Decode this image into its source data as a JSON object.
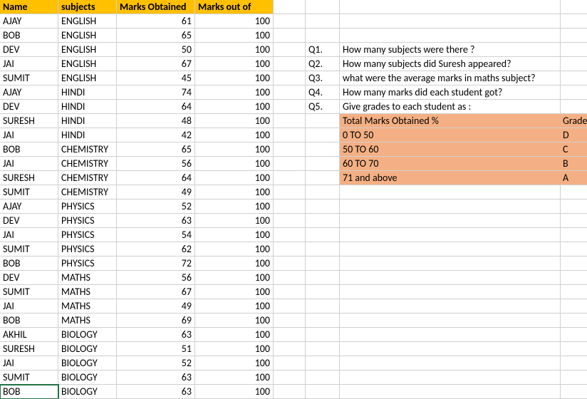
{
  "headers": {
    "name": "Name",
    "subjects": "subjects",
    "marks_obtained": "Marks Obtained",
    "marks_out_of": "Marks out of"
  },
  "rows": [
    {
      "name": "AJAY",
      "subject": "ENGLISH",
      "obtained": "61",
      "outof": "100"
    },
    {
      "name": "BOB",
      "subject": "ENGLISH",
      "obtained": "65",
      "outof": "100"
    },
    {
      "name": "DEV",
      "subject": "ENGLISH",
      "obtained": "50",
      "outof": "100"
    },
    {
      "name": "JAI",
      "subject": "ENGLISH",
      "obtained": "67",
      "outof": "100"
    },
    {
      "name": "SUMIT",
      "subject": "ENGLISH",
      "obtained": "45",
      "outof": "100"
    },
    {
      "name": "AJAY",
      "subject": "HINDI",
      "obtained": "74",
      "outof": "100"
    },
    {
      "name": "DEV",
      "subject": "HINDI",
      "obtained": "64",
      "outof": "100"
    },
    {
      "name": "SURESH",
      "subject": "HINDI",
      "obtained": "48",
      "outof": "100"
    },
    {
      "name": "JAI",
      "subject": "HINDI",
      "obtained": "42",
      "outof": "100"
    },
    {
      "name": "BOB",
      "subject": "CHEMISTRY",
      "obtained": "65",
      "outof": "100"
    },
    {
      "name": "JAI",
      "subject": "CHEMISTRY",
      "obtained": "56",
      "outof": "100"
    },
    {
      "name": "SURESH",
      "subject": "CHEMISTRY",
      "obtained": "64",
      "outof": "100"
    },
    {
      "name": "SUMIT",
      "subject": "CHEMISTRY",
      "obtained": "49",
      "outof": "100"
    },
    {
      "name": "AJAY",
      "subject": "PHYSICS",
      "obtained": "52",
      "outof": "100"
    },
    {
      "name": "DEV",
      "subject": "PHYSICS",
      "obtained": "63",
      "outof": "100"
    },
    {
      "name": "JAI",
      "subject": "PHYSICS",
      "obtained": "54",
      "outof": "100"
    },
    {
      "name": "SUMIT",
      "subject": "PHYSICS",
      "obtained": "62",
      "outof": "100"
    },
    {
      "name": "BOB",
      "subject": "PHYSICS",
      "obtained": "72",
      "outof": "100"
    },
    {
      "name": "DEV",
      "subject": "MATHS",
      "obtained": "56",
      "outof": "100"
    },
    {
      "name": "SUMIT",
      "subject": "MATHS",
      "obtained": "67",
      "outof": "100"
    },
    {
      "name": "JAI",
      "subject": "MATHS",
      "obtained": "49",
      "outof": "100"
    },
    {
      "name": "BOB",
      "subject": "MATHS",
      "obtained": "69",
      "outof": "100"
    },
    {
      "name": "AKHIL",
      "subject": "BIOLOGY",
      "obtained": "63",
      "outof": "100"
    },
    {
      "name": "SURESH",
      "subject": "BIOLOGY",
      "obtained": "51",
      "outof": "100"
    },
    {
      "name": "JAI",
      "subject": "BIOLOGY",
      "obtained": "52",
      "outof": "100"
    },
    {
      "name": "SUMIT",
      "subject": "BIOLOGY",
      "obtained": "63",
      "outof": "100"
    },
    {
      "name": "BOB",
      "subject": "BIOLOGY",
      "obtained": "63",
      "outof": "100"
    }
  ],
  "questions": [
    {
      "label": "Q1.",
      "text": "How many subjects were there ?"
    },
    {
      "label": "Q2.",
      "text": "How many subjects did Suresh appeared?"
    },
    {
      "label": "Q3.",
      "text": "what were the average marks in maths subject?"
    },
    {
      "label": "Q4.",
      "text": "How many marks did each student got?"
    },
    {
      "label": "Q5.",
      "text": "Give grades to each student as :"
    }
  ],
  "grade_table": {
    "header_left": "Total Marks Obtained %",
    "header_right": "Grade",
    "rows": [
      {
        "range": "0 TO 50",
        "grade": "D"
      },
      {
        "range": "50 TO 60",
        "grade": "C"
      },
      {
        "range": "60 TO 70",
        "grade": "B"
      },
      {
        "range": "71 and above",
        "grade": "A"
      }
    ]
  }
}
